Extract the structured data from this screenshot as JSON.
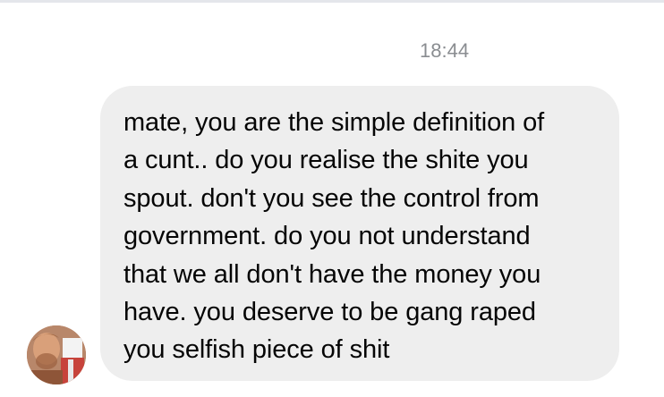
{
  "conversation": {
    "timestamp": "18:44",
    "messages": [
      {
        "sender": "other",
        "text": "mate, you are the simple definition of\na cunt.. do you realise the shite you\nspout. don't you see the control from\ngovernment. do you not understand\nthat we all don't have the money you\nhave. you deserve to be gang raped\nyou selfish piece of shit"
      }
    ]
  },
  "colors": {
    "bubble_background": "#eeeeee",
    "message_text": "#050505",
    "timestamp_text": "#8a8d91"
  },
  "icons": {
    "avatar": "user-avatar-photo"
  }
}
